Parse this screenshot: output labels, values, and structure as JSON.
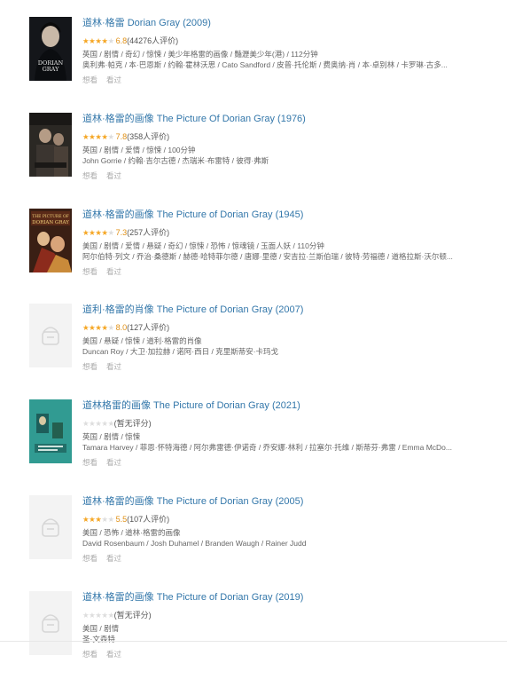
{
  "colors": {
    "link": "#3377aa",
    "star": "#f5a623",
    "score": "#e09015",
    "meta": "#666666"
  },
  "items": [
    {
      "title": "道林·格雷 Dorian Gray (2009)",
      "stars": 3.5,
      "score": "6.8",
      "count": "(44276人评价)",
      "line1": "英国 / 剧情 / 奇幻 / 惊悚 / 美少年格雷的画像 / 豔瀝美少年(港) / 112分钟",
      "line2": "奥利弗·帕克 / 本·巴恩斯 / 约翰·霍林沃思 / Cato Sandford / 皮普·托伦斯 / 费奥纳·肖 / 本·卓别林 / 卡罗琳·古多...",
      "want": "想看",
      "seen": "看过",
      "poster": {
        "kind": "portrait",
        "icon": "poster-dorian-gray-2009-icon",
        "text": "DORIAN GRAY"
      }
    },
    {
      "title": "道林·格雷的画像 The Picture Of Dorian Gray (1976)",
      "stars": 4,
      "score": "7.8",
      "count": "(358人评价)",
      "line1": "英国 / 剧情 / 爱情 / 惊悚 / 100分钟",
      "line2": "John Gorrie / 约翰·吉尔古德 / 杰瑞米·布雷特 / 彼得·弗斯",
      "want": "想看",
      "seen": "看过",
      "poster": {
        "kind": "still",
        "icon": "poster-dorian-gray-1976-icon"
      }
    },
    {
      "title": "道林·格雷的画像 The Picture of Dorian Gray (1945)",
      "stars": 3.5,
      "score": "7.3",
      "count": "(257人评价)",
      "line1": "美国 / 剧情 / 爱情 / 悬疑 / 奇幻 / 惊悚 / 恐怖 / 惊魂镜 / 玉面人妖 / 110分钟",
      "line2": "阿尔伯特·列文 / 乔治·桑德斯 / 赫德·哈特菲尔德 / 唐娜·里德 / 安吉拉·兰斯伯瑞 / 彼特·劳福德 / 道格拉斯·沃尔顿...",
      "want": "想看",
      "seen": "看过",
      "poster": {
        "kind": "illustrated",
        "icon": "poster-dorian-gray-1945-icon"
      }
    },
    {
      "title": "道利·格雷的肖像 The Picture of Dorian Gray (2007)",
      "stars": 4,
      "score": "8.0",
      "count": "(127人评价)",
      "line1": "美国 / 悬疑 / 惊悚 / 道利·格雷的肖像",
      "line2": "Duncan Roy / 大卫·加拉赫 / 诺阿·西日 / 克里斯蒂安·卡玛戈",
      "want": "想看",
      "seen": "看过",
      "poster": {
        "kind": "placeholder",
        "icon": "poster-placeholder-icon"
      }
    },
    {
      "title": "道林格雷的画像 The Picture of Dorian Gray (2021)",
      "stars": 0,
      "score": "",
      "count": "(暂无评分)",
      "line1": "英国 / 剧情 / 惊悚",
      "line2": "Tamara Harvey / 菲恩·怀特海德 / 阿尔弗雷德·伊诺奇 / 乔安娜·林利 / 拉塞尔·托维 / 斯蒂芬·弗雷 / Emma McDo...",
      "want": "想看",
      "seen": "看过",
      "poster": {
        "kind": "teal",
        "icon": "poster-dorian-gray-2021-icon"
      }
    },
    {
      "title": "道林·格雷的画像 The Picture of Dorian Gray (2005)",
      "stars": 3,
      "score": "5.5",
      "count": "(107人评价)",
      "line1": "美国 / 恐怖 / 道林·格雷的画像",
      "line2": "David Rosenbaum / Josh Duhamel / Branden Waugh / Rainer Judd",
      "want": "想看",
      "seen": "看过",
      "poster": {
        "kind": "placeholder",
        "icon": "poster-placeholder-icon"
      }
    },
    {
      "title": "道林·格雷的画像 The Picture of Dorian Gray (2019)",
      "stars": 0,
      "score": "",
      "count": "(暂无评分)",
      "line1": "美国 / 剧情",
      "line2": "圣·文森特",
      "want": "想看",
      "seen": "看过",
      "poster": {
        "kind": "placeholder",
        "icon": "poster-placeholder-icon"
      }
    }
  ]
}
